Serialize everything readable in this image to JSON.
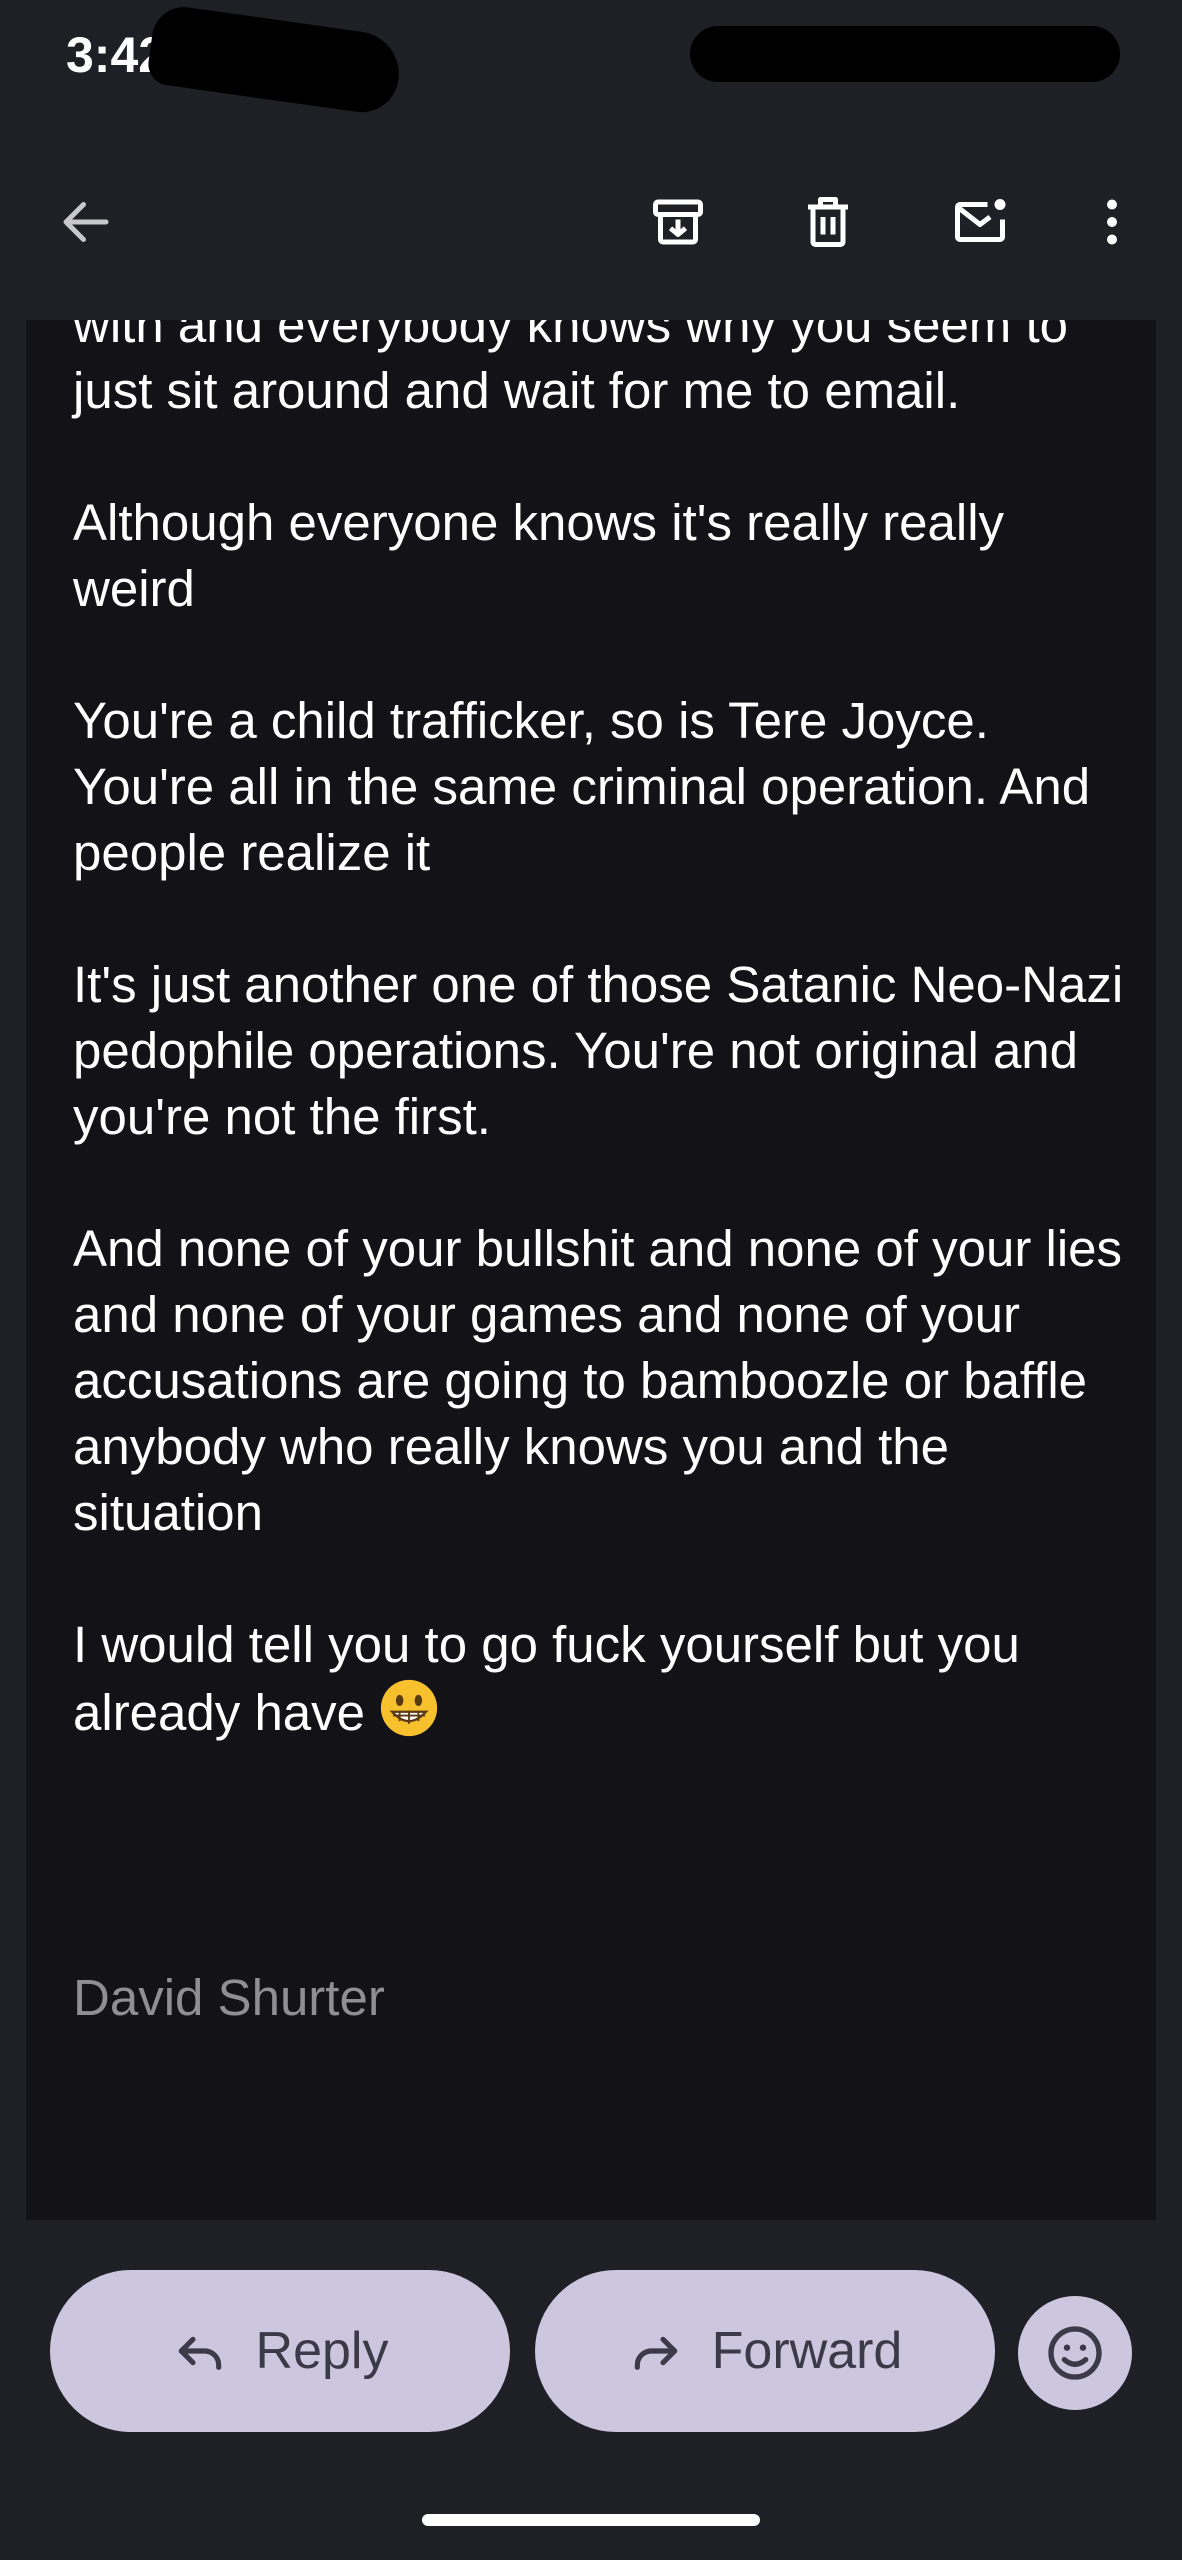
{
  "status_bar": {
    "time": "3:42"
  },
  "toolbar": {
    "back_icon": "arrow-left-icon",
    "archive_icon": "archive-icon",
    "delete_icon": "trash-icon",
    "mark_unread_icon": "mail-unread-icon",
    "more_icon": "more-vertical-icon"
  },
  "email": {
    "paragraphs": [
      "with and everybody knows why you seem to just sit around and wait for me to email.",
      "Although everyone knows it's really really weird",
      "You're a child trafficker, so is Tere Joyce. You're all in the same criminal operation. And people realize it",
      "It's just another one of those Satanic Neo-Nazi pedophile operations. You're not original and you're not the first.",
      "And none of your bullshit and none of your lies and none of your games and none of your accusations are going to bamboozle or baffle anybody who really knows you and the situation",
      "I would tell you to go fuck yourself but you already have"
    ],
    "trailing_emoji": "grinning-face-emoji",
    "signature": "David Shurter"
  },
  "actions": {
    "reply_label": "Reply",
    "forward_label": "Forward",
    "emoji_icon": "emoji-reaction-icon"
  },
  "colors": {
    "background": "#1f1f26",
    "card": "#121217",
    "pill": "#cdc6df",
    "pill_text": "#3b3a48",
    "signature": "#8e8e94"
  }
}
